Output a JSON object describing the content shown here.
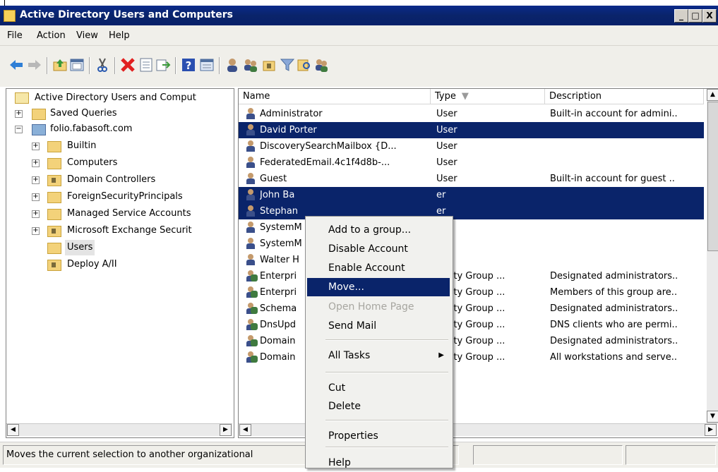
{
  "window": {
    "title": "Active Directory Users and Computers",
    "buttons": [
      "_",
      "□",
      "X"
    ]
  },
  "menu": [
    "File",
    "Action",
    "View",
    "Help"
  ],
  "toolbar_icons": [
    "back-arrow-icon",
    "forward-arrow-icon",
    "up-folder-icon",
    "show-console-tree-icon",
    "cut-icon",
    "delete-icon",
    "properties-icon",
    "export-list-icon",
    "help-icon",
    "details-icon",
    "user-icon",
    "users-icon",
    "ou-icon",
    "filter-icon",
    "find-icon",
    "group-icon"
  ],
  "tree": {
    "root": "Active Directory Users and Comput",
    "items": [
      {
        "label": "Saved Queries",
        "expander": "+"
      },
      {
        "label": "folio.fabasoft.com",
        "expander": "−"
      },
      {
        "label": "Builtin",
        "expander": "+"
      },
      {
        "label": "Computers",
        "expander": "+"
      },
      {
        "label": "Domain Controllers",
        "expander": "+"
      },
      {
        "label": "ForeignSecurityPrincipals",
        "expander": "+"
      },
      {
        "label": "Managed Service Accounts",
        "expander": "+"
      },
      {
        "label": "Microsoft Exchange Securit",
        "expander": "+"
      },
      {
        "label": "Users",
        "expander": ""
      },
      {
        "label": "Deploy A/II",
        "expander": ""
      }
    ]
  },
  "list": {
    "columns": [
      "Name",
      "Type",
      "Description"
    ],
    "rows": [
      {
        "name": "Administrator",
        "type": "User",
        "desc": "Built-in account for admini..",
        "sel": false,
        "icon": "user"
      },
      {
        "name": "David Porter",
        "type": "User",
        "desc": "",
        "sel": true,
        "icon": "user"
      },
      {
        "name": "DiscoverySearchMailbox {D...",
        "type": "User",
        "desc": "",
        "sel": false,
        "icon": "user"
      },
      {
        "name": "FederatedEmail.4c1f4d8b-...",
        "type": "User",
        "desc": "",
        "sel": false,
        "icon": "user"
      },
      {
        "name": "Guest",
        "type": "User",
        "desc": "Built-in account for guest ..",
        "sel": false,
        "icon": "user"
      },
      {
        "name": "John Ba",
        "type": "er",
        "desc": "",
        "sel": true,
        "icon": "user"
      },
      {
        "name": "Stephan",
        "type": "er",
        "desc": "",
        "sel": true,
        "icon": "user"
      },
      {
        "name": "SystemM",
        "type": "er",
        "desc": "",
        "sel": false,
        "icon": "user"
      },
      {
        "name": "SystemM",
        "type": "er",
        "desc": "",
        "sel": false,
        "icon": "user"
      },
      {
        "name": "Walter H",
        "type": "er",
        "desc": "",
        "sel": false,
        "icon": "user"
      },
      {
        "name": "Enterpri",
        "type": "curity Group ...",
        "desc": "Designated administrators..",
        "sel": false,
        "icon": "group"
      },
      {
        "name": "Enterpri",
        "type": "curity Group ...",
        "desc": "Members of this group are..",
        "sel": false,
        "icon": "group"
      },
      {
        "name": "Schema",
        "type": "curity Group ...",
        "desc": "Designated administrators..",
        "sel": false,
        "icon": "group"
      },
      {
        "name": "DnsUpd",
        "type": "curity Group ...",
        "desc": "DNS clients who are permi..",
        "sel": false,
        "icon": "group"
      },
      {
        "name": "Domain",
        "type": "curity Group ...",
        "desc": "Designated administrators..",
        "sel": false,
        "icon": "group"
      },
      {
        "name": "Domain",
        "type": "curity Group ...",
        "desc": "All workstations and serve..",
        "sel": false,
        "icon": "group"
      }
    ]
  },
  "context_menu": {
    "items": [
      {
        "label": "Add to a group...",
        "state": "normal"
      },
      {
        "label": "Disable Account",
        "state": "normal"
      },
      {
        "label": "Enable Account",
        "state": "normal"
      },
      {
        "label": "Move...",
        "state": "highlighted"
      },
      {
        "label": "Open Home Page",
        "state": "disabled"
      },
      {
        "label": "Send Mail",
        "state": "normal"
      },
      {
        "label": "All Tasks",
        "state": "submenu"
      },
      {
        "label": "Cut",
        "state": "normal"
      },
      {
        "label": "Delete",
        "state": "normal"
      },
      {
        "label": "Properties",
        "state": "normal"
      },
      {
        "label": "Help",
        "state": "normal"
      }
    ]
  },
  "status": {
    "text": "Moves the current selection to another organizational"
  },
  "colors": {
    "selection": "#0a246a",
    "title_bar": "#0a246a"
  }
}
